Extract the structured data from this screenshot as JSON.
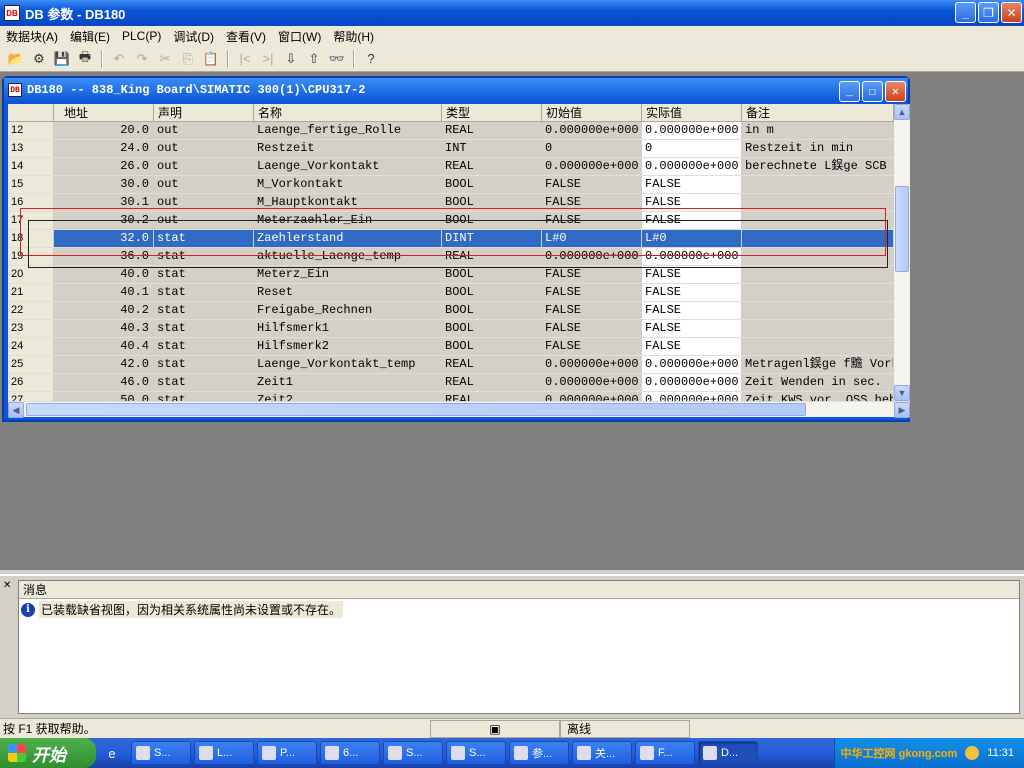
{
  "window_title": "DB 参数 - DB180",
  "menu": [
    "数据块(A)",
    "编辑(E)",
    "PLC(P)",
    "调试(D)",
    "查看(V)",
    "窗口(W)",
    "帮助(H)"
  ],
  "child_title": "DB180 -- 838_King Board\\SIMATIC 300(1)\\CPU317-2",
  "columns": [
    "地址",
    "声明",
    "名称",
    "类型",
    "初始值",
    "实际值",
    "备注"
  ],
  "rows": [
    {
      "no": "12",
      "addr": "20.0",
      "decl": "out",
      "name": "Laenge_fertige_Rolle",
      "type": "REAL",
      "init": "0.000000e+000",
      "actual": "0.000000e+000",
      "comment": "in m"
    },
    {
      "no": "13",
      "addr": "24.0",
      "decl": "out",
      "name": "Restzeit",
      "type": "INT",
      "init": "0",
      "actual": "0",
      "comment": "Restzeit in min"
    },
    {
      "no": "14",
      "addr": "26.0",
      "decl": "out",
      "name": "Laenge_Vorkontakt",
      "type": "REAL",
      "init": "0.000000e+000",
      "actual": "0.000000e+000",
      "comment": "berechnete L鋘ge SCB I"
    },
    {
      "no": "15",
      "addr": "30.0",
      "decl": "out",
      "name": "M_Vorkontakt",
      "type": "BOOL",
      "init": "FALSE",
      "actual": "FALSE",
      "comment": ""
    },
    {
      "no": "16",
      "addr": "30.1",
      "decl": "out",
      "name": "M_Hauptkontakt",
      "type": "BOOL",
      "init": "FALSE",
      "actual": "FALSE",
      "comment": ""
    },
    {
      "no": "17",
      "addr": "30.2",
      "decl": "out",
      "name": "Meterzaehler_Ein",
      "type": "BOOL",
      "init": "FALSE",
      "actual": "FALSE",
      "comment": ""
    },
    {
      "no": "18",
      "addr": "32.0",
      "decl": "stat",
      "name": "Zaehlerstand",
      "type": "DINT",
      "init": "L#0",
      "actual": "L#0",
      "comment": "",
      "selected": true
    },
    {
      "no": "19",
      "addr": "36.0",
      "decl": "stat",
      "name": "aktuelle_Laenge_temp",
      "type": "REAL",
      "init": "0.000000e+000",
      "actual": "0.000000e+000",
      "comment": ""
    },
    {
      "no": "20",
      "addr": "40.0",
      "decl": "stat",
      "name": "Meterz_Ein",
      "type": "BOOL",
      "init": "FALSE",
      "actual": "FALSE",
      "comment": ""
    },
    {
      "no": "21",
      "addr": "40.1",
      "decl": "stat",
      "name": "Reset",
      "type": "BOOL",
      "init": "FALSE",
      "actual": "FALSE",
      "comment": ""
    },
    {
      "no": "22",
      "addr": "40.2",
      "decl": "stat",
      "name": "Freigabe_Rechnen",
      "type": "BOOL",
      "init": "FALSE",
      "actual": "FALSE",
      "comment": ""
    },
    {
      "no": "23",
      "addr": "40.3",
      "decl": "stat",
      "name": "Hilfsmerk1",
      "type": "BOOL",
      "init": "FALSE",
      "actual": "FALSE",
      "comment": ""
    },
    {
      "no": "24",
      "addr": "40.4",
      "decl": "stat",
      "name": "Hilfsmerk2",
      "type": "BOOL",
      "init": "FALSE",
      "actual": "FALSE",
      "comment": ""
    },
    {
      "no": "25",
      "addr": "42.0",
      "decl": "stat",
      "name": "Laenge_Vorkontakt_temp",
      "type": "REAL",
      "init": "0.000000e+000",
      "actual": "0.000000e+000",
      "comment": "Metragenl鋘ge f黵 Vork"
    },
    {
      "no": "26",
      "addr": "46.0",
      "decl": "stat",
      "name": "Zeit1",
      "type": "REAL",
      "init": "0.000000e+000",
      "actual": "0.000000e+000",
      "comment": "Zeit Wenden in sec."
    },
    {
      "no": "27",
      "addr": "50.0",
      "decl": "stat",
      "name": "Zeit2",
      "type": "REAL",
      "init": "0.000000e+000",
      "actual": "0.000000e+000",
      "comment": "Zeit KWS vor. OSS heb"
    }
  ],
  "msg_header": "消息",
  "msg_text": "已装载缺省视图，因为相关系统属性尚未设置或不存在。",
  "status_help": "按 F1 获取帮助。",
  "status_mode": "离线",
  "start_label": "开始",
  "tasks": [
    "S...",
    "L...",
    "P...",
    "6...",
    "S...",
    "S...",
    "参...",
    "关...",
    "F...",
    "D..."
  ],
  "clock": "11:31",
  "watermark": "中华工控网 gkong.com"
}
